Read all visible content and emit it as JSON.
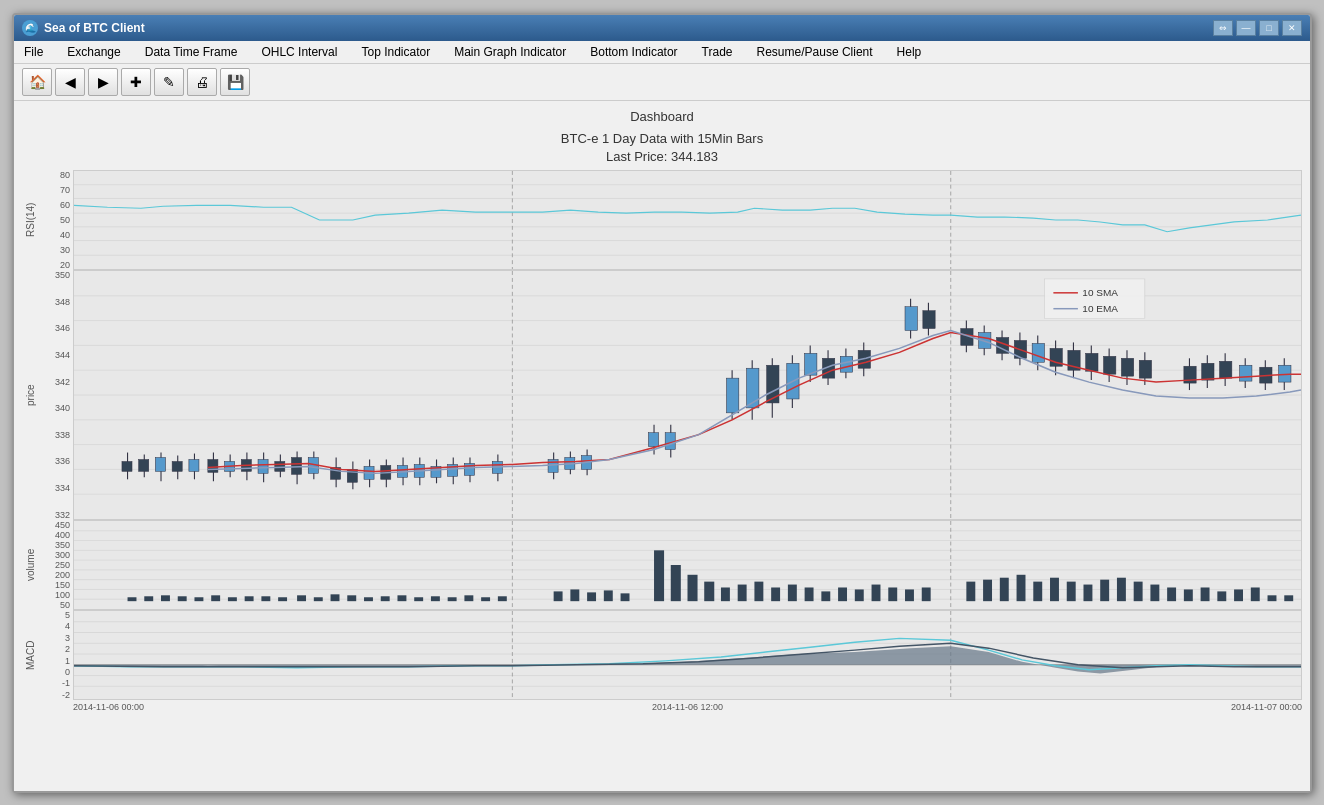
{
  "window": {
    "title": "Sea of BTC Client",
    "controls": [
      "⇔",
      "—",
      "□",
      "✕"
    ]
  },
  "menu": {
    "items": [
      "File",
      "Exchange",
      "Data Time Frame",
      "OHLC Interval",
      "Top Indicator",
      "Main Graph Indicator",
      "Bottom Indicator",
      "Trade",
      "Resume/Pause Client",
      "Help"
    ]
  },
  "toolbar": {
    "buttons": [
      "🏠",
      "◀",
      "▶",
      "+",
      "✎",
      "🖨",
      "💾"
    ]
  },
  "dashboard": {
    "title": "Dashboard"
  },
  "chart": {
    "title_line1": "BTC-e 1 Day Data with 15Min Bars",
    "title_line2": "Last Price: 344.183",
    "legend": {
      "sma_label": "10 SMA",
      "ema_label": "10 EMA",
      "sma_color": "#cc3333",
      "ema_color": "#8899aa"
    },
    "rsi": {
      "y_label": "RSI(14)",
      "y_ticks": [
        "80",
        "70",
        "60",
        "50",
        "40",
        "30",
        "20"
      ]
    },
    "price": {
      "y_label": "price",
      "y_ticks": [
        "350",
        "348",
        "346",
        "344",
        "342",
        "340",
        "338",
        "336",
        "334",
        "332"
      ]
    },
    "volume": {
      "y_label": "volume",
      "y_ticks": [
        "450",
        "400",
        "350",
        "300",
        "250",
        "200",
        "150",
        "100",
        "50"
      ]
    },
    "macd": {
      "y_label": "MACD",
      "y_ticks": [
        "5",
        "4",
        "3",
        "2",
        "1",
        "0",
        "-1",
        "-2"
      ]
    },
    "x_axis": {
      "labels": [
        "2014-11-06 00:00",
        "2014-11-06 12:00",
        "2014-11-07 00:00"
      ]
    }
  }
}
